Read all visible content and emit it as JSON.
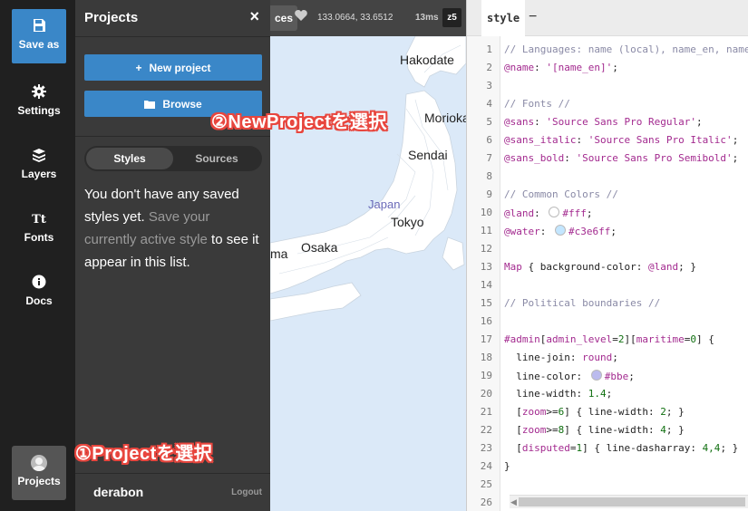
{
  "nav": {
    "save_label": "Save as",
    "settings_label": "Settings",
    "layers_label": "Layers",
    "fonts_label": "Fonts",
    "fonts_icon_text": "Tt",
    "docs_label": "Docs",
    "projects_label": "Projects"
  },
  "panel": {
    "title": "Projects",
    "close": "×",
    "new_project": "New project",
    "new_project_plus": "+",
    "browse": "Browse",
    "tabs": {
      "styles": "Styles",
      "sources": "Sources"
    },
    "empty_part1": "You don't have any saved styles yet. ",
    "empty_part2": "Save your currently active style",
    "empty_part3": " to see it appear in this list.",
    "user": "derabon",
    "logout": "Logout"
  },
  "map": {
    "chip": "ces",
    "coords": "133.0664, 33.6512",
    "render_time": "13ms",
    "zoom": "z5",
    "cities": {
      "hakodate": "Hakodate",
      "morioka": "Morioka",
      "sendai": "Sendai",
      "tokyo": "Tokyo",
      "osaka": "Osaka",
      "ma": "ma"
    },
    "country": "Japan",
    "colors": {
      "land": "#ffffff",
      "water": "#c3e6ff"
    }
  },
  "editor": {
    "tab": "style",
    "tab_minus": "−",
    "lines": {
      "l1": "// Languages: name (local), name_en, name_",
      "l2a": "@name",
      "l2b": ": ",
      "l2c": "'[name_en]'",
      "l2d": ";",
      "l4": "// Fonts //",
      "l5a": "@sans",
      "l5b": ": ",
      "l5c": "'Source Sans Pro Regular'",
      "l5d": ";",
      "l6a": "@sans_italic",
      "l6b": ": ",
      "l6c": "'Source Sans Pro Italic'",
      "l6d": ";",
      "l7a": "@sans_bold",
      "l7b": ": ",
      "l7c": "'Source Sans Pro Semibold'",
      "l7d": ";",
      "l9": "// Common Colors //",
      "l10a": "@land",
      "l10b": ": ",
      "l10c": "#fff",
      "l10d": ";",
      "l11a": "@water",
      "l11b": ": ",
      "l11c": "#c3e6ff",
      "l11d": ";",
      "l13a": "Map",
      "l13b": " { background-color: ",
      "l13c": "@land",
      "l13d": "; }",
      "l15": "// Political boundaries //",
      "l17a": "#admin",
      "l17b": "[",
      "l17c": "admin_level",
      "l17d": "=",
      "l17e": "2",
      "l17f": "][",
      "l17g": "maritime",
      "l17h": "=",
      "l17i": "0",
      "l17j": "] {",
      "l18a": "  line-join: ",
      "l18b": "round",
      "l18c": ";",
      "l19a": "  line-color: ",
      "l19b": "#bbe",
      "l19c": ";",
      "l20a": "  line-width: ",
      "l20b": "1.4",
      "l20c": ";",
      "l21a": "  [",
      "l21b": "zoom",
      "l21c": ">=",
      "l21d": "6",
      "l21e": "] { line-width: ",
      "l21f": "2",
      "l21g": "; }",
      "l22a": "  [",
      "l22b": "zoom",
      "l22c": ">=",
      "l22d": "8",
      "l22e": "] { line-width: ",
      "l22f": "4",
      "l22g": "; }",
      "l23a": "  [",
      "l23b": "disputed",
      "l23c": "=",
      "l23d": "1",
      "l23e": "] { line-dasharray: ",
      "l23f": "4,4",
      "l23g": "; }",
      "l24": "}"
    },
    "line_numbers": [
      "1",
      "2",
      "3",
      "4",
      "5",
      "6",
      "7",
      "8",
      "9",
      "10",
      "11",
      "12",
      "13",
      "14",
      "15",
      "16",
      "17",
      "18",
      "19",
      "20",
      "21",
      "22",
      "23",
      "24",
      "25",
      "26"
    ],
    "swatches": {
      "land": "#ffffff",
      "water": "#c3e6ff",
      "line": "#bbbbee"
    }
  },
  "annotations": {
    "step2": "②NewProjectを選択",
    "step1": "①Projectを選択",
    "color": "#e8463e"
  }
}
